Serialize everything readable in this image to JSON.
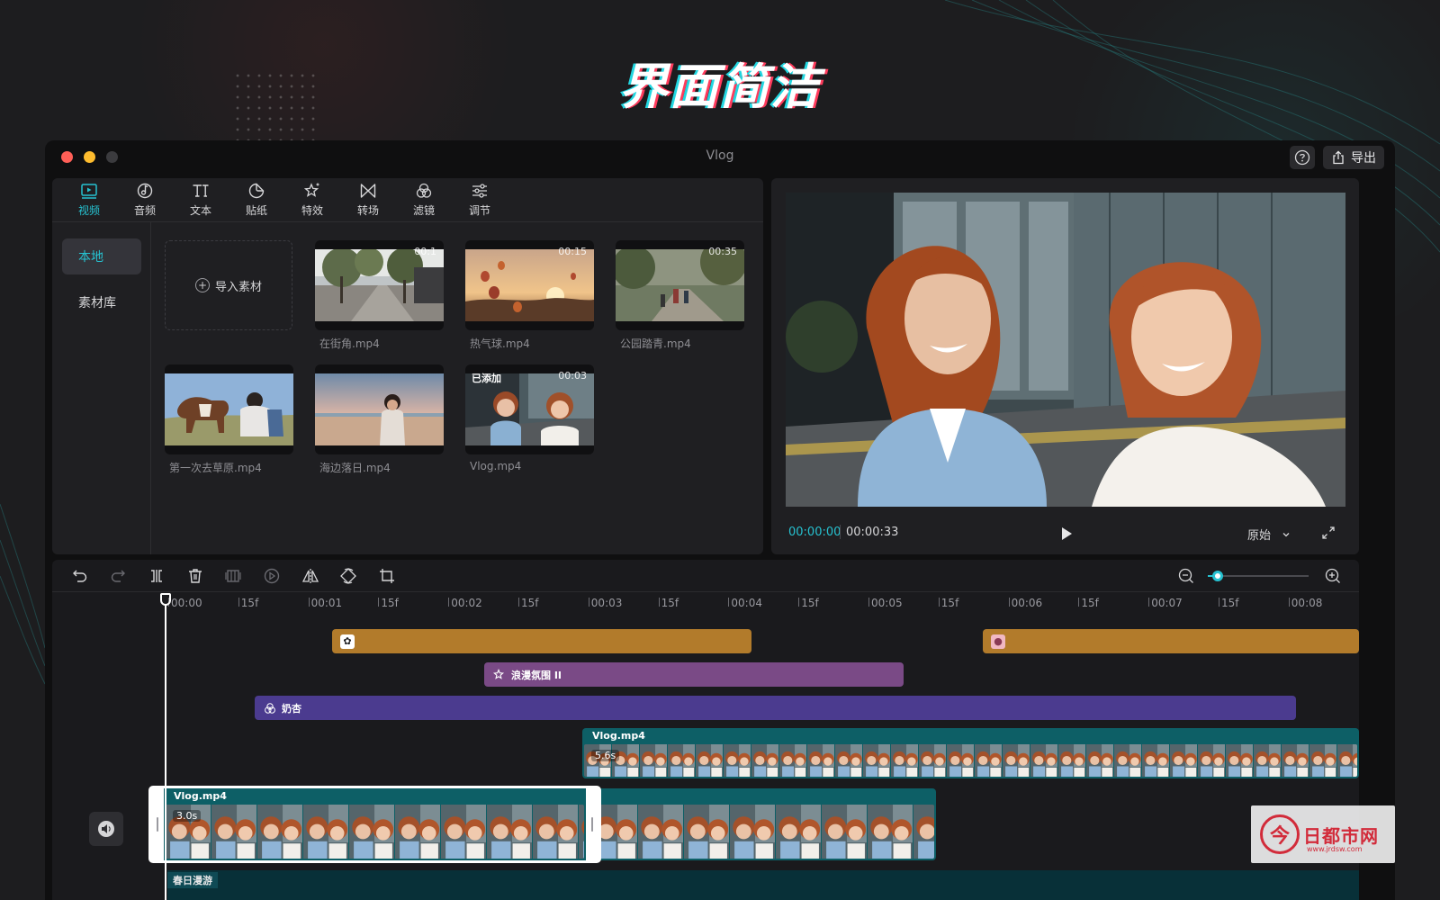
{
  "hero_title": "界面简洁",
  "window": {
    "title": "Vlog",
    "export_label": "导出"
  },
  "toolbar_tabs": [
    {
      "label": "视频",
      "icon": "video-icon",
      "active": true
    },
    {
      "label": "音频",
      "icon": "music-note-icon",
      "active": false
    },
    {
      "label": "文本",
      "icon": "text-icon",
      "active": false
    },
    {
      "label": "贴纸",
      "icon": "sticker-icon",
      "active": false
    },
    {
      "label": "特效",
      "icon": "sparkle-star-icon",
      "active": false
    },
    {
      "label": "转场",
      "icon": "transition-bowtie-icon",
      "active": false
    },
    {
      "label": "滤镜",
      "icon": "filter-circles-icon",
      "active": false
    },
    {
      "label": "调节",
      "icon": "sliders-icon",
      "active": false
    }
  ],
  "side_nav": [
    {
      "label": "本地",
      "active": true
    },
    {
      "label": "素材库",
      "active": false
    }
  ],
  "import_label": "导入素材",
  "media": [
    {
      "name": "在街角.mp4",
      "duration": "00:1",
      "added": false
    },
    {
      "name": "热气球.mp4",
      "duration": "00:15",
      "added": false
    },
    {
      "name": "公园踏青.mp4",
      "duration": "00:35",
      "added": false
    },
    {
      "name": "第一次去草原.mp4",
      "duration": "",
      "added": false
    },
    {
      "name": "海边落日.mp4",
      "duration": "",
      "added": false
    },
    {
      "name": "Vlog.mp4",
      "duration": "00:03",
      "added": true,
      "added_label": "已添加"
    }
  ],
  "player": {
    "current_time": "00:00:00",
    "total_time": "00:00:33",
    "ratio_label": "原始"
  },
  "timeline": {
    "zoom_level": 0.1,
    "ruler_labels": [
      "00:00",
      "15f",
      "00:01",
      "15f",
      "00:02",
      "15f",
      "00:03",
      "15f",
      "00:04",
      "15f",
      "00:05",
      "15f",
      "00:06",
      "15f",
      "00:07",
      "15f",
      "00:08"
    ],
    "effect_label": "浪漫氛围 II",
    "filter_label": "奶杏",
    "overlay_clip": {
      "name": "Vlog.mp4",
      "duration": "5.6s"
    },
    "main_clip": {
      "name": "Vlog.mp4",
      "duration": "3.0s"
    },
    "music_label": "春日漫游"
  },
  "colors": {
    "accent": "#26c2d1",
    "sticker_track": "#b27b2b",
    "effect_track": "#7a4a86",
    "filter_track": "#4b3b8f",
    "video_track": "#0d5f66"
  },
  "watermark": {
    "glyph": "今",
    "text": "日都市网",
    "sub": "www.jrdsw.com"
  }
}
